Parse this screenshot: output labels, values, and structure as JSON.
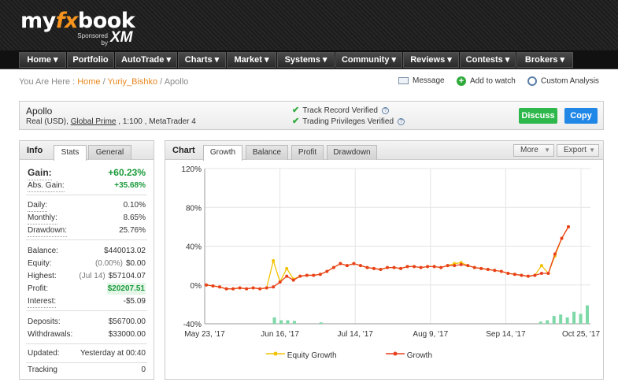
{
  "header": {
    "logo_prefix": "my",
    "logo_fx": "fx",
    "logo_suffix": "book",
    "sponsor_line1": "Sponsored",
    "sponsor_line2": "by",
    "sponsor_brand": "XM"
  },
  "nav": [
    {
      "label": "Home ▾"
    },
    {
      "label": "Portfolio"
    },
    {
      "label": "AutoTrade ▾"
    },
    {
      "label": "Charts ▾"
    },
    {
      "label": "Market ▾"
    },
    {
      "label": "Systems ▾"
    },
    {
      "label": "Community ▾"
    },
    {
      "label": "Reviews ▾"
    },
    {
      "label": "Contests ▾"
    },
    {
      "label": "Brokers ▾"
    }
  ],
  "breadcrumb": {
    "prefix": "You Are Here : ",
    "home": "Home",
    "sep1": " / ",
    "user": "Yuriy_Bishko",
    "sep2": " / ",
    "current": "Apollo"
  },
  "actions": {
    "message": "Message",
    "watch": "Add to watch",
    "analysis": "Custom Analysis"
  },
  "account": {
    "name": "Apollo",
    "meta_prefix": "Real (USD), ",
    "broker": "Global Prime",
    "meta_suffix": " , 1:100 , MetaTrader 4",
    "verify1": "Track Record Verified",
    "verify2": "Trading Privileges Verified",
    "discuss": "Discuss",
    "copy": "Copy"
  },
  "info": {
    "title": "Info",
    "tab_stats": "Stats",
    "tab_general": "General",
    "gain_label": "Gain:",
    "gain_value": "+60.23%",
    "abs_gain_label": "Abs. Gain:",
    "abs_gain_value": "+35.68%",
    "daily_label": "Daily:",
    "daily_value": "0.10%",
    "monthly_label": "Monthly:",
    "monthly_value": "8.65%",
    "drawdown_label": "Drawdown:",
    "drawdown_value": "25.76%",
    "balance_label": "Balance:",
    "balance_value": "$440013.02",
    "equity_label": "Equity:",
    "equity_sub": "(0.00%)",
    "equity_value": "$0.00",
    "highest_label": "Highest:",
    "highest_sub": "(Jul 14)",
    "highest_value": "$57104.07",
    "profit_label": "Profit:",
    "profit_value": "$20207.51",
    "interest_label": "Interest:",
    "interest_value": "-$5.09",
    "deposits_label": "Deposits:",
    "deposits_value": "$56700.00",
    "withdrawals_label": "Withdrawals:",
    "withdrawals_value": "$33000.00",
    "updated_label": "Updated:",
    "updated_value": "Yesterday at 00:40",
    "tracking_label": "Tracking",
    "tracking_value": "0"
  },
  "chart_panel": {
    "title": "Chart",
    "tabs": [
      "Growth",
      "Balance",
      "Profit",
      "Drawdown"
    ],
    "more": "More",
    "export": "Export"
  },
  "colors": {
    "growth": "#e8401c",
    "equity_growth": "#f2c200",
    "bars": "#7ed9a8"
  },
  "chart_data": {
    "type": "line",
    "ylim": [
      -40,
      120
    ],
    "yticks": [
      "120%",
      "80%",
      "40%",
      "0%",
      "-40%"
    ],
    "ytick_values": [
      120,
      80,
      40,
      0,
      -40
    ],
    "xticks": [
      "May 23, '17",
      "Jun 16, '17",
      "Jul 14, '17",
      "Aug 9, '17",
      "Sep 14, '17",
      "Oct 25, '17"
    ],
    "series": [
      {
        "name": "Equity Growth",
        "values": [
          0,
          -1,
          -2,
          -4,
          -4,
          -3,
          -4,
          -3,
          -4,
          -3,
          25,
          3,
          17,
          6,
          9,
          10,
          10,
          11,
          14,
          18,
          22,
          20,
          22,
          20,
          18,
          17,
          16,
          18,
          18,
          17,
          19,
          19,
          18,
          19,
          19,
          18,
          20,
          22,
          23,
          20,
          18,
          17,
          16,
          15,
          14,
          12,
          11,
          10,
          9,
          10,
          20,
          12,
          30,
          48,
          60
        ]
      },
      {
        "name": "Growth",
        "values": [
          0,
          -1,
          -2,
          -4,
          -4,
          -3,
          -4,
          -3,
          -4,
          -3,
          -2,
          3,
          9,
          5,
          9,
          10,
          10,
          11,
          14,
          18,
          22,
          20,
          22,
          20,
          18,
          17,
          16,
          18,
          18,
          17,
          19,
          19,
          18,
          19,
          19,
          18,
          20,
          20,
          21,
          20,
          18,
          17,
          16,
          15,
          14,
          12,
          11,
          10,
          9,
          10,
          12,
          12,
          32,
          48,
          60
        ]
      }
    ],
    "bars": [
      0,
      0,
      0,
      0,
      0,
      0,
      0,
      0,
      0,
      0,
      9,
      5,
      5,
      4,
      0,
      0,
      0,
      2,
      0,
      0,
      0,
      0,
      0,
      0,
      0,
      0,
      0,
      0,
      0,
      0,
      0,
      0,
      0,
      0,
      0,
      0,
      0,
      0,
      0,
      0,
      0,
      0,
      0,
      0,
      0,
      0,
      0,
      0,
      0,
      0,
      3,
      5,
      11,
      13,
      9,
      17,
      14,
      26
    ]
  }
}
